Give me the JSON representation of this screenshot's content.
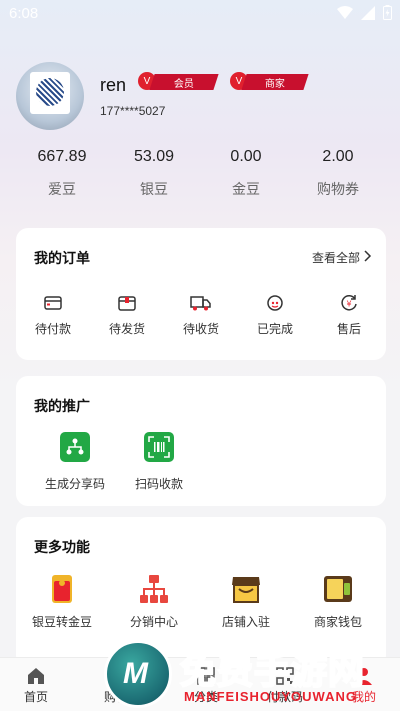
{
  "status": {
    "time": "6:08"
  },
  "profile": {
    "username": "ren",
    "phone": "177****5027",
    "badges": [
      {
        "icon": "V",
        "label": "会员"
      },
      {
        "icon": "V",
        "label": "商家"
      }
    ]
  },
  "stats": [
    {
      "value": "667.89",
      "label": "爱豆"
    },
    {
      "value": "53.09",
      "label": "银豆"
    },
    {
      "value": "0.00",
      "label": "金豆"
    },
    {
      "value": "2.00",
      "label": "购物券"
    }
  ],
  "orders": {
    "title": "我的订单",
    "view_all": "查看全部",
    "items": [
      {
        "label": "待付款",
        "icon": "card-icon"
      },
      {
        "label": "待发货",
        "icon": "box-icon"
      },
      {
        "label": "待收货",
        "icon": "truck-icon"
      },
      {
        "label": "已完成",
        "icon": "completed-icon"
      },
      {
        "label": "售后",
        "icon": "after-sale-icon"
      }
    ]
  },
  "promotion": {
    "title": "我的推广",
    "items": [
      {
        "label": "生成分享码",
        "icon": "share-tree-icon"
      },
      {
        "label": "扫码收款",
        "icon": "scan-barcode-icon"
      }
    ]
  },
  "more": {
    "title": "更多功能",
    "items": [
      {
        "label": "银豆转金豆",
        "icon": "red-envelope-icon"
      },
      {
        "label": "分销中心",
        "icon": "org-chart-icon"
      },
      {
        "label": "店铺入驻",
        "icon": "shop-icon"
      },
      {
        "label": "商家钱包",
        "icon": "wallet-icon"
      }
    ]
  },
  "tabbar": [
    {
      "label": "首页",
      "icon": "home-icon"
    },
    {
      "label": "购物",
      "icon": "cart-icon"
    },
    {
      "label": "分类",
      "icon": "category-icon"
    },
    {
      "label": "付款码",
      "icon": "qr-icon"
    },
    {
      "label": "我的",
      "icon": "user-icon"
    }
  ],
  "watermark": {
    "title": "免费手游网",
    "subtitle": "MANFEISHOUYOUWANG"
  },
  "colors": {
    "accent_red": "#c8102e",
    "green": "#22a845",
    "card_bg": "#ffffff"
  }
}
